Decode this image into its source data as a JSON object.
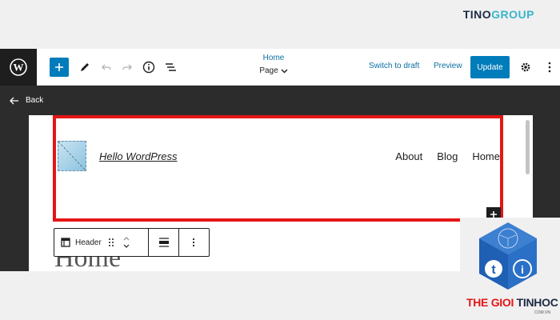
{
  "watermark": {
    "brand_dark": "TINO",
    "brand_accent": "GROUP"
  },
  "toolbar": {
    "doc_name": "Home",
    "doc_type": "Page",
    "switch_to_draft": "Switch to draft",
    "preview": "Preview",
    "update": "Update"
  },
  "canvas": {
    "back_label": "Back"
  },
  "site": {
    "title": "Hello WordPress",
    "nav": [
      "About",
      "Blog",
      "Home"
    ]
  },
  "block_toolbar": {
    "block_label": "Header"
  },
  "page": {
    "heading": "Home"
  },
  "corner_brand": {
    "part1": "THE GIOI",
    "part2": "TINHOC",
    "domain": "COM.VN"
  },
  "colors": {
    "accent": "#007cba",
    "highlight": "#e31616",
    "dark": "#1e1e1e"
  }
}
